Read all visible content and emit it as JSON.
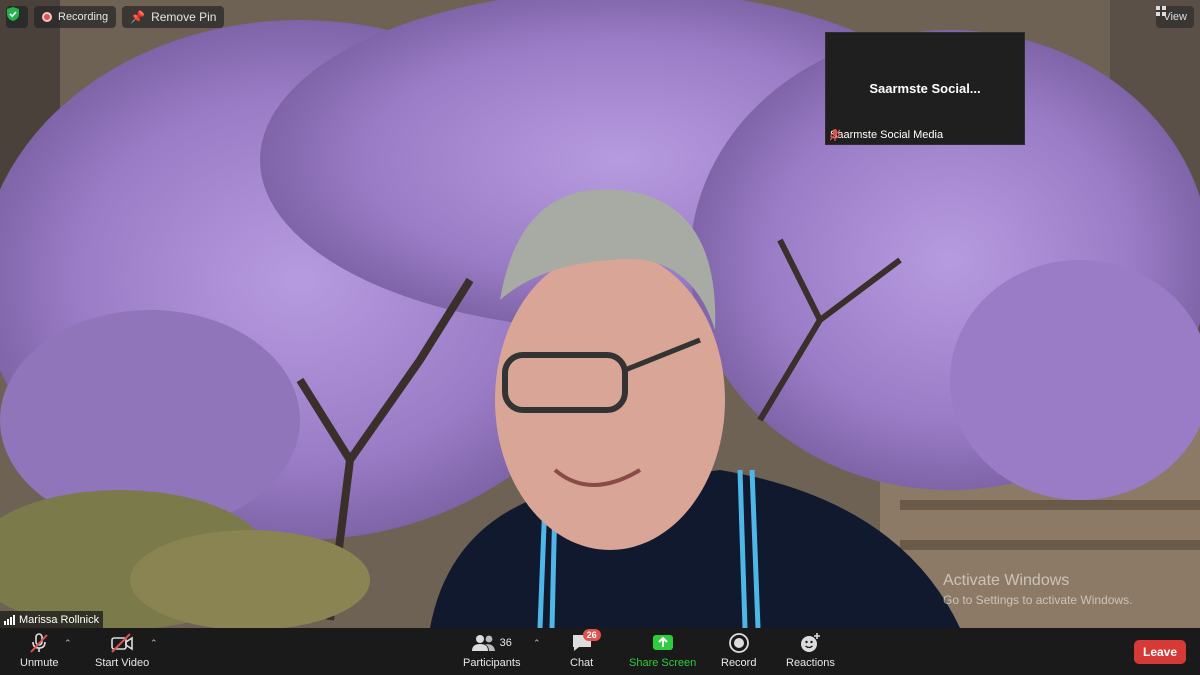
{
  "top_bar": {
    "recording_label": "Recording",
    "remove_pin_label": "Remove Pin",
    "view_label": "View"
  },
  "thumbnail": {
    "display_name": "Saarmste  Social...",
    "participant_name": "Saarmste Social Media"
  },
  "main_video": {
    "participant_name": "Marissa Rollnick"
  },
  "watermark": {
    "line1": "Activate Windows",
    "line2": "Go to Settings to activate Windows."
  },
  "toolbar": {
    "unmute_label": "Unmute",
    "start_video_label": "Start Video",
    "participants_label": "Participants",
    "participants_count": "36",
    "chat_label": "Chat",
    "chat_badge": "26",
    "share_screen_label": "Share Screen",
    "record_label": "Record",
    "reactions_label": "Reactions",
    "leave_label": "Leave"
  },
  "colors": {
    "toolbar_bg": "#1a1a1a",
    "share_green": "#2ecc40",
    "leave_red": "#d63a36",
    "badge_red": "#e0524f",
    "blossom_purple": "#9b7fc4"
  },
  "icons": {
    "security": "shield-check-icon",
    "recording": "recording-dot-icon",
    "pin": "pin-icon",
    "view": "grid-view-icon",
    "mic_off": "mic-muted-icon",
    "video_off": "video-off-icon",
    "participants": "people-icon",
    "chat": "chat-bubble-icon",
    "share": "share-screen-icon",
    "record": "record-icon",
    "reactions": "emoji-plus-icon"
  }
}
